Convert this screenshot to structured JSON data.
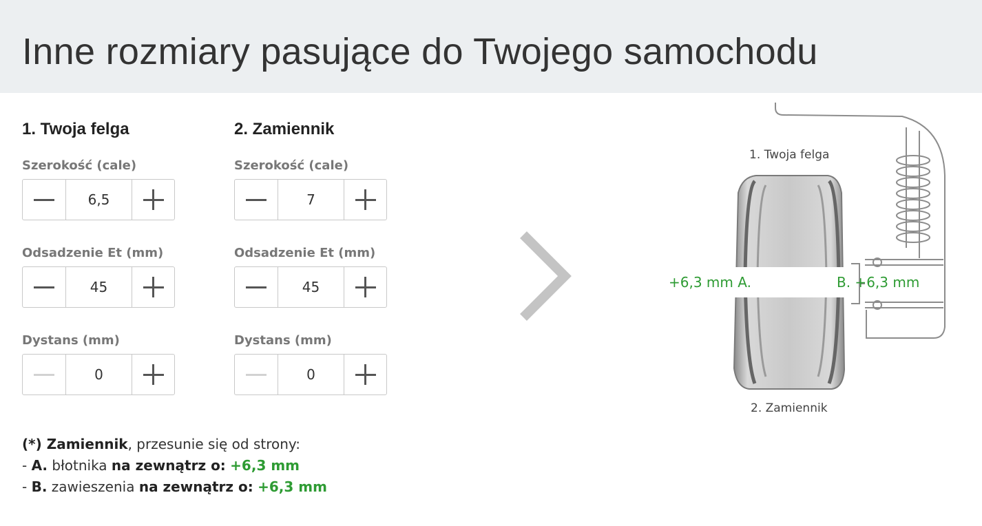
{
  "header": {
    "title": "Inne rozmiary pasujące do Twojego samochodu"
  },
  "columns": [
    {
      "title": "1. Twoja felga",
      "fields": [
        {
          "label": "Szerokość (cale)",
          "value": "6,5"
        },
        {
          "label": "Odsadzenie Et (mm)",
          "value": "45"
        },
        {
          "label": "Dystans (mm)",
          "value": "0"
        }
      ]
    },
    {
      "title": "2. Zamiennik",
      "fields": [
        {
          "label": "Szerokość (cale)",
          "value": "7"
        },
        {
          "label": "Odsadzenie Et (mm)",
          "value": "45"
        },
        {
          "label": "Dystans (mm)",
          "value": "0"
        }
      ]
    }
  ],
  "diagram": {
    "top_label": "1. Twoja felga",
    "bottom_label": "2. Zamiennik",
    "left_measure": "+6,3 mm A.",
    "right_measure": "B. +6,3 mm"
  },
  "note": {
    "prefix": "(*) Zamiennik",
    "intro": ", przesunie się od strony:",
    "line_a": {
      "dash": "- ",
      "letter": "A.",
      "text": " błotnika ",
      "direction": "na zewnątrz o:",
      "value": "+6,3 mm"
    },
    "line_b": {
      "dash": "- ",
      "letter": "B.",
      "text": " zawieszenia ",
      "direction": "na zewnątrz o:",
      "value": "+6,3 mm"
    }
  },
  "colors": {
    "accent_green": "#2e9b33",
    "header_bg": "#eceff1",
    "label_gray": "#777777"
  },
  "icons": {
    "minus": "minus-icon",
    "plus": "plus-icon",
    "arrow": "chevron-right-icon"
  }
}
